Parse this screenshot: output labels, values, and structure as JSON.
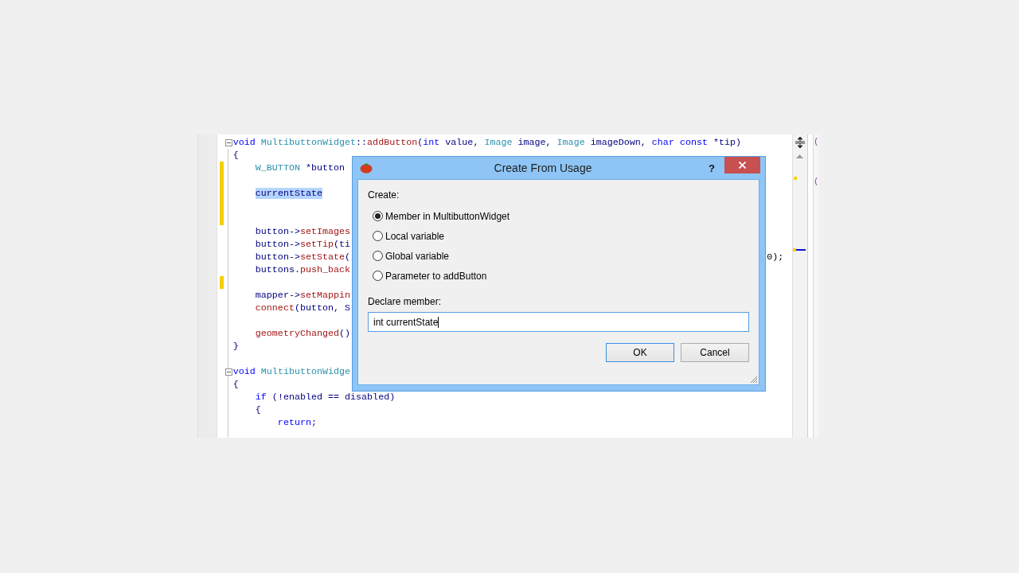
{
  "editor": {
    "lines": [
      {
        "changed": false,
        "foldable": true,
        "tokens": [
          {
            "kind": "kw",
            "text": "void"
          },
          {
            "kind": "type",
            "text": " MultibuttonWidget"
          },
          {
            "kind": "id",
            "text": "::"
          },
          {
            "kind": "fn",
            "text": "addButton"
          },
          {
            "kind": "id",
            "text": "("
          },
          {
            "kind": "kw",
            "text": "int"
          },
          {
            "kind": "id",
            "text": " value, "
          },
          {
            "kind": "type",
            "text": "Image"
          },
          {
            "kind": "id",
            "text": " image, "
          },
          {
            "kind": "type",
            "text": "Image"
          },
          {
            "kind": "id",
            "text": " imageDown, "
          },
          {
            "kind": "kw",
            "text": "char"
          },
          {
            "kind": "kw",
            "text": " const"
          },
          {
            "kind": "id",
            "text": " *tip)"
          }
        ]
      },
      {
        "changed": false,
        "foldable": false,
        "tokens": [
          {
            "kind": "id",
            "text": "{"
          }
        ]
      },
      {
        "changed": true,
        "foldable": false,
        "tokens": [
          {
            "kind": "type",
            "text": "    W_BUTTON"
          },
          {
            "kind": "id",
            "text": " *button"
          }
        ]
      },
      {
        "changed": true,
        "foldable": false
      },
      {
        "changed": true,
        "foldable": false,
        "tokens": [
          {
            "kind": "hl",
            "text": "    currentState"
          }
        ]
      },
      {
        "changed": true,
        "foldable": false
      },
      {
        "changed": true,
        "foldable": false
      },
      {
        "changed": false,
        "foldable": false,
        "tokens": [
          {
            "kind": "id",
            "text": "    button->"
          },
          {
            "kind": "fn",
            "text": "setImages"
          }
        ]
      },
      {
        "changed": false,
        "foldable": false,
        "tokens": [
          {
            "kind": "id",
            "text": "    button->"
          },
          {
            "kind": "fn",
            "text": "setTip"
          },
          {
            "kind": "id",
            "text": "(ti"
          }
        ]
      },
      {
        "changed": false,
        "foldable": false,
        "tokens": [
          {
            "kind": "id",
            "text": "    button->"
          },
          {
            "kind": "fn",
            "text": "setState"
          },
          {
            "kind": "id",
            "text": "("
          }
        ],
        "tail": "0);"
      },
      {
        "changed": false,
        "foldable": false,
        "tokens": [
          {
            "kind": "id",
            "text": "    buttons."
          },
          {
            "kind": "fn",
            "text": "push_back"
          }
        ]
      },
      {
        "changed": true,
        "foldable": false
      },
      {
        "changed": false,
        "foldable": false,
        "tokens": [
          {
            "kind": "id",
            "text": "    mapper->"
          },
          {
            "kind": "fn",
            "text": "setMappin"
          }
        ]
      },
      {
        "changed": false,
        "foldable": false,
        "tokens": [
          {
            "kind": "fn",
            "text": "    connect"
          },
          {
            "kind": "id",
            "text": "(button, S"
          }
        ]
      },
      {
        "changed": false,
        "foldable": false
      },
      {
        "changed": false,
        "foldable": false,
        "tokens": [
          {
            "kind": "fn",
            "text": "    geometryChanged"
          },
          {
            "kind": "id",
            "text": "()"
          }
        ]
      },
      {
        "changed": false,
        "foldable": false,
        "tokens": [
          {
            "kind": "id",
            "text": "}"
          }
        ]
      },
      {
        "changed": false,
        "foldable": false
      },
      {
        "changed": false,
        "foldable": true,
        "tokens": [
          {
            "kind": "kw",
            "text": "void"
          },
          {
            "kind": "type",
            "text": " MultibuttonWidge"
          }
        ]
      },
      {
        "changed": false,
        "foldable": false,
        "tokens": [
          {
            "kind": "id",
            "text": "{"
          }
        ]
      },
      {
        "changed": false,
        "foldable": false,
        "tokens": [
          {
            "kind": "kw",
            "text": "    if"
          },
          {
            "kind": "id",
            "text": " (!enabled == disabled)"
          }
        ]
      },
      {
        "changed": false,
        "foldable": false,
        "tokens": [
          {
            "kind": "id",
            "text": "    {"
          }
        ]
      },
      {
        "changed": false,
        "foldable": false,
        "tokens": [
          {
            "kind": "kw",
            "text": "        return"
          },
          {
            "kind": "id",
            "text": ";"
          }
        ]
      }
    ]
  },
  "side_pane": {
    "lines": [
      "(",
      "("
    ]
  },
  "dialog": {
    "title": "Create From Usage",
    "help": "?",
    "create_label": "Create:",
    "options": [
      {
        "label": "Member in MultibuttonWidget",
        "selected": true
      },
      {
        "label": "Local variable",
        "selected": false
      },
      {
        "label": "Global variable",
        "selected": false
      },
      {
        "label": "Parameter to addButton",
        "selected": false
      }
    ],
    "declare_label": "Declare member:",
    "declaration": "int currentState",
    "buttons": [
      {
        "label": "OK",
        "default": true
      },
      {
        "label": "Cancel",
        "default": false
      }
    ]
  }
}
